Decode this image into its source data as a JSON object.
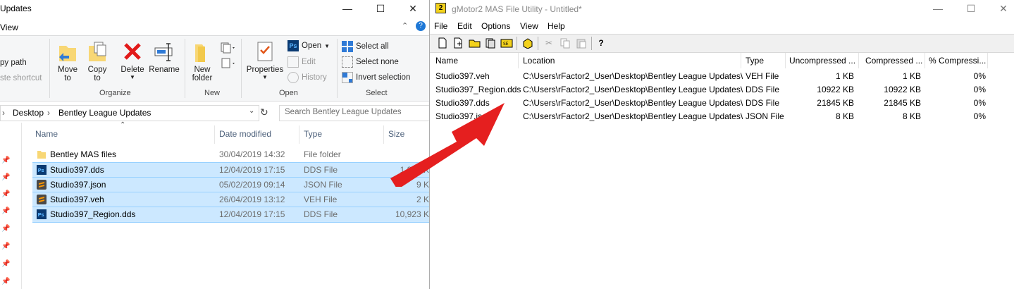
{
  "explorer": {
    "title": "Updates",
    "view_tab": "View",
    "ribbon": {
      "copy_path": "py path",
      "paste_shortcut": "ste shortcut",
      "move_to": "Move",
      "move_to2": "to",
      "copy_to": "Copy",
      "copy_to2": "to",
      "delete": "Delete",
      "rename": "Rename",
      "new_folder": "New",
      "new_folder2": "folder",
      "properties": "Properties",
      "open": "Open",
      "edit": "Edit",
      "history": "History",
      "select_all": "Select all",
      "select_none": "Select none",
      "invert_selection": "Invert selection",
      "groups": {
        "organize": "Organize",
        "new": "New",
        "open": "Open",
        "select": "Select"
      }
    },
    "breadcrumb": {
      "item1": "Desktop",
      "item2": "Bentley League Updates"
    },
    "search_placeholder": "Search Bentley League Updates",
    "columns": {
      "name": "Name",
      "date": "Date modified",
      "type": "Type",
      "size": "Size"
    },
    "files": [
      {
        "name": "Bentley MAS files",
        "date": "30/04/2019 14:32",
        "type": "File folder",
        "size": "",
        "icon": "folder-icon",
        "selected": false
      },
      {
        "name": "Studio397.dds",
        "date": "12/04/2019 17:15",
        "type": "DDS File",
        "size": "1,846 K",
        "icon": "photoshop-icon",
        "selected": true
      },
      {
        "name": "Studio397.json",
        "date": "05/02/2019 09:14",
        "type": "JSON File",
        "size": "9 K",
        "icon": "sublime-icon",
        "selected": true
      },
      {
        "name": "Studio397.veh",
        "date": "26/04/2019 13:12",
        "type": "VEH File",
        "size": "2 K",
        "icon": "sublime-icon",
        "selected": true
      },
      {
        "name": "Studio397_Region.dds",
        "date": "12/04/2019 17:15",
        "type": "DDS File",
        "size": "10,923 K",
        "icon": "photoshop-icon",
        "selected": true
      }
    ]
  },
  "gmotor": {
    "title": "gMotor2 MAS File Utility - Untitled*",
    "menus": [
      "File",
      "Edit",
      "Options",
      "View",
      "Help"
    ],
    "columns": {
      "name": "Name",
      "location": "Location",
      "type": "Type",
      "uncompressed": "Uncompressed ...",
      "compressed": "Compressed ...",
      "pct": "% Compressi..."
    },
    "rows": [
      {
        "name": "Studio397.veh",
        "location": "C:\\Users\\rFactor2_User\\Desktop\\Bentley League Updates\\",
        "type": "VEH File",
        "uncompressed": "1 KB",
        "compressed": "1 KB",
        "pct": "0%"
      },
      {
        "name": "Studio397_Region.dds",
        "location": "C:\\Users\\rFactor2_User\\Desktop\\Bentley League Updates\\",
        "type": "DDS File",
        "uncompressed": "10922 KB",
        "compressed": "10922 KB",
        "pct": "0%"
      },
      {
        "name": "Studio397.dds",
        "location": "C:\\Users\\rFactor2_User\\Desktop\\Bentley League Updates\\",
        "type": "DDS File",
        "uncompressed": "21845 KB",
        "compressed": "21845 KB",
        "pct": "0%"
      },
      {
        "name": "Studio397.json",
        "location": "C:\\Users\\rFactor2_User\\Desktop\\Bentley League Updates\\",
        "type": "JSON File",
        "uncompressed": "8 KB",
        "compressed": "8 KB",
        "pct": "0%"
      }
    ]
  },
  "colors": {
    "selection": "#cce8ff",
    "selection_border": "#99d1ff",
    "arrow": "#e51f1f",
    "header_text": "#4c607a"
  }
}
